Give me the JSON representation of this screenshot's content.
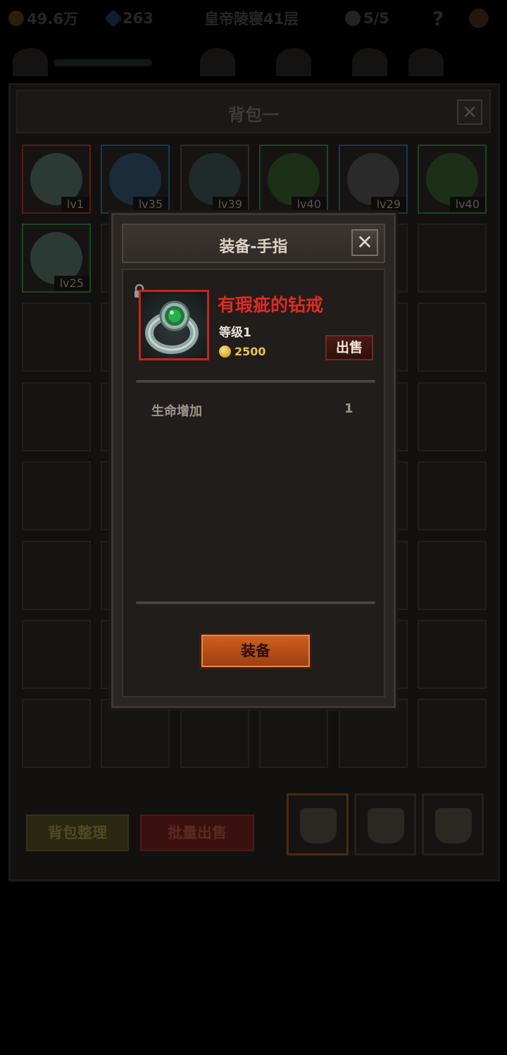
{
  "topbar": {
    "gold": "49.6万",
    "gems": "263",
    "location": "皇帝陵寝41层",
    "keys": "5/5",
    "help": "?"
  },
  "bag": {
    "title": "背包一",
    "close": "✕",
    "items": [
      {
        "lv": "lv1",
        "rarity": "red",
        "icon": "green-gem-ring-icon"
      },
      {
        "lv": "lv35",
        "rarity": "blue",
        "icon": "blue-armor-icon"
      },
      {
        "lv": "lv39",
        "rarity": "gray",
        "icon": "orb-icon"
      },
      {
        "lv": "lv40",
        "rarity": "green",
        "icon": "green-gauntlet-icon"
      },
      {
        "lv": "lv29",
        "rarity": "blue",
        "icon": "helmet-icon"
      },
      {
        "lv": "lv40",
        "rarity": "green",
        "icon": "green-gauntlet-icon"
      },
      {
        "lv": "lv25",
        "rarity": "green",
        "icon": "green-gem-ring-icon"
      }
    ],
    "sort_button": "背包整理",
    "batch_sell_button": "批量出售"
  },
  "modal": {
    "title": "装备-手指",
    "close": "✕",
    "item": {
      "name": "有瑕疵的钻戒",
      "level": "等级1",
      "price": "2500",
      "sell_button": "出售",
      "icon": "green-gem-ring-icon",
      "name_color": "#e12a22"
    },
    "stats": [
      {
        "label": "生命增加",
        "value": "1"
      }
    ],
    "equip_button": "装备"
  }
}
